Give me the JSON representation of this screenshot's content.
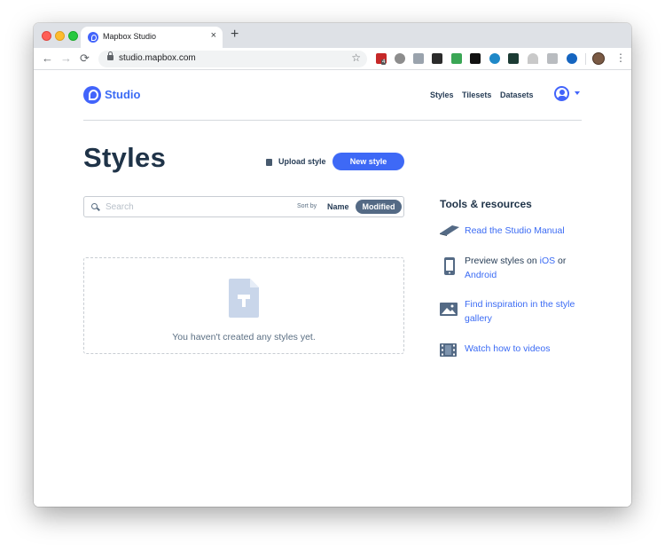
{
  "browser": {
    "tab_title": "Mapbox Studio",
    "tab_close": "×",
    "new_tab": "+",
    "url": "studio.mapbox.com",
    "back": "←",
    "forward": "→",
    "reload": "⟳",
    "star": "☆",
    "menu": "⋮",
    "extension_badge": "4"
  },
  "header": {
    "logo_text": "Studio",
    "nav": [
      "Styles",
      "Tilesets",
      "Datasets"
    ]
  },
  "main": {
    "title": "Styles",
    "upload_label": "Upload style",
    "new_style_label": "New style",
    "search_placeholder": "Search",
    "sort_by_label": "Sort by",
    "sort_options": [
      "Name",
      "Modified"
    ],
    "sort_selected": "Modified",
    "empty_message": "You haven't created any styles yet."
  },
  "tools": {
    "title": "Tools & resources",
    "manual": "Read the Studio Manual",
    "preview_prefix": "Preview styles on ",
    "preview_ios": "iOS",
    "preview_or": " or",
    "preview_android": "Android",
    "inspiration": "Find inspiration in the style gallery",
    "videos": "Watch how to videos"
  },
  "colors": {
    "brand": "#4264fb",
    "button": "#3e69f6",
    "heading": "#1f3348",
    "link": "#3b6bf4"
  }
}
